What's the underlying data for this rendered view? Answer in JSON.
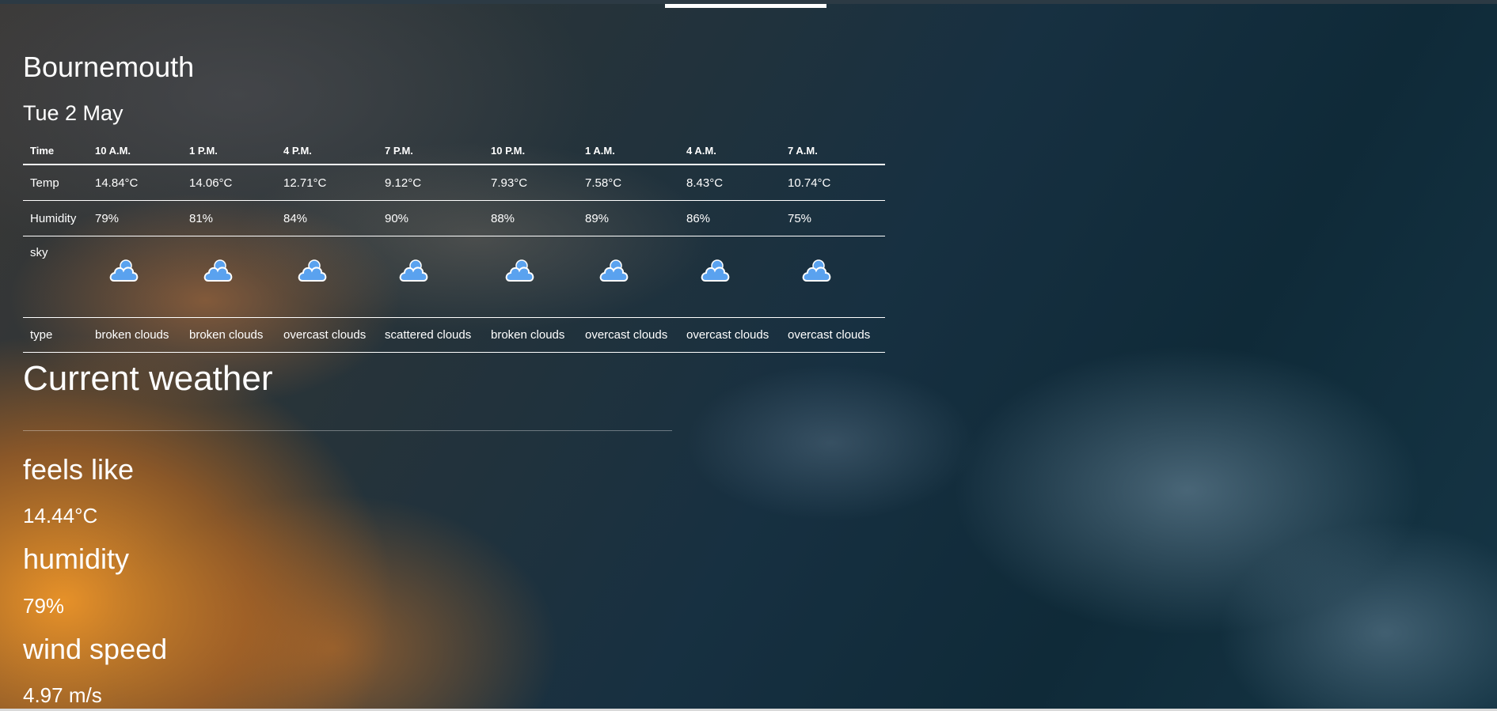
{
  "location": {
    "city": "Bournemouth",
    "date": "Tue 2 May"
  },
  "forecast": {
    "row_labels": {
      "time": "Time",
      "temp": "Temp",
      "humidity": "Humidity",
      "sky": "sky",
      "type": "type"
    },
    "slots": [
      {
        "time": "10 A.M.",
        "temp": "14.84°C",
        "humidity": "79%",
        "sky_icon": "broken-clouds-icon",
        "type": "broken clouds"
      },
      {
        "time": "1 P.M.",
        "temp": "14.06°C",
        "humidity": "81%",
        "sky_icon": "broken-clouds-icon",
        "type": "broken clouds"
      },
      {
        "time": "4 P.M.",
        "temp": "12.71°C",
        "humidity": "84%",
        "sky_icon": "overcast-clouds-icon",
        "type": "overcast clouds"
      },
      {
        "time": "7 P.M.",
        "temp": "9.12°C",
        "humidity": "90%",
        "sky_icon": "scattered-clouds-icon",
        "type": "scattered clouds"
      },
      {
        "time": "10 P.M.",
        "temp": "7.93°C",
        "humidity": "88%",
        "sky_icon": "broken-clouds-icon",
        "type": "broken clouds"
      },
      {
        "time": "1 A.M.",
        "temp": "7.58°C",
        "humidity": "89%",
        "sky_icon": "overcast-clouds-icon",
        "type": "overcast clouds"
      },
      {
        "time": "4 A.M.",
        "temp": "8.43°C",
        "humidity": "86%",
        "sky_icon": "overcast-clouds-icon",
        "type": "overcast clouds"
      },
      {
        "time": "7 A.M.",
        "temp": "10.74°C",
        "humidity": "75%",
        "sky_icon": "overcast-clouds-icon",
        "type": "overcast clouds"
      }
    ]
  },
  "current": {
    "title": "Current weather",
    "feels_like_label": "feels like",
    "feels_like_value": "14.44°C",
    "humidity_label": "humidity",
    "humidity_value": "79%",
    "wind_label": "wind speed",
    "wind_value": "4.97 m/s"
  },
  "colors": {
    "cloud_icon": "#5aa2ef",
    "text": "#ffffff"
  }
}
